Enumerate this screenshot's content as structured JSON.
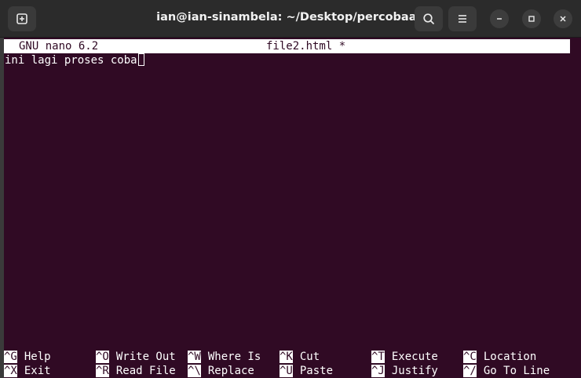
{
  "window": {
    "title": "ian@ian-sinambela: ~/Desktop/percobaan",
    "icons": {
      "new_tab": "new-tab-icon",
      "search": "search-icon",
      "menu": "hamburger-menu-icon",
      "minimize": "minimize-icon",
      "maximize": "maximize-icon",
      "close": "close-icon"
    }
  },
  "nano": {
    "app_version": "GNU nano 6.2",
    "filename": "file2.html *",
    "content_line": "ini lagi proses coba"
  },
  "shortcuts": {
    "row1": [
      {
        "key": "^G",
        "label": "Help"
      },
      {
        "key": "^O",
        "label": "Write Out"
      },
      {
        "key": "^W",
        "label": "Where Is"
      },
      {
        "key": "^K",
        "label": "Cut"
      },
      {
        "key": "^T",
        "label": "Execute"
      },
      {
        "key": "^C",
        "label": "Location"
      }
    ],
    "row2": [
      {
        "key": "^X",
        "label": "Exit"
      },
      {
        "key": "^R",
        "label": "Read File"
      },
      {
        "key": "^\\",
        "label": "Replace"
      },
      {
        "key": "^U",
        "label": "Paste"
      },
      {
        "key": "^J",
        "label": "Justify"
      },
      {
        "key": "^/",
        "label": "Go To Line"
      }
    ]
  },
  "colors": {
    "terminal_bg": "#300a24",
    "titlebar_bg": "#2b2b2b",
    "text": "#ffffff"
  }
}
